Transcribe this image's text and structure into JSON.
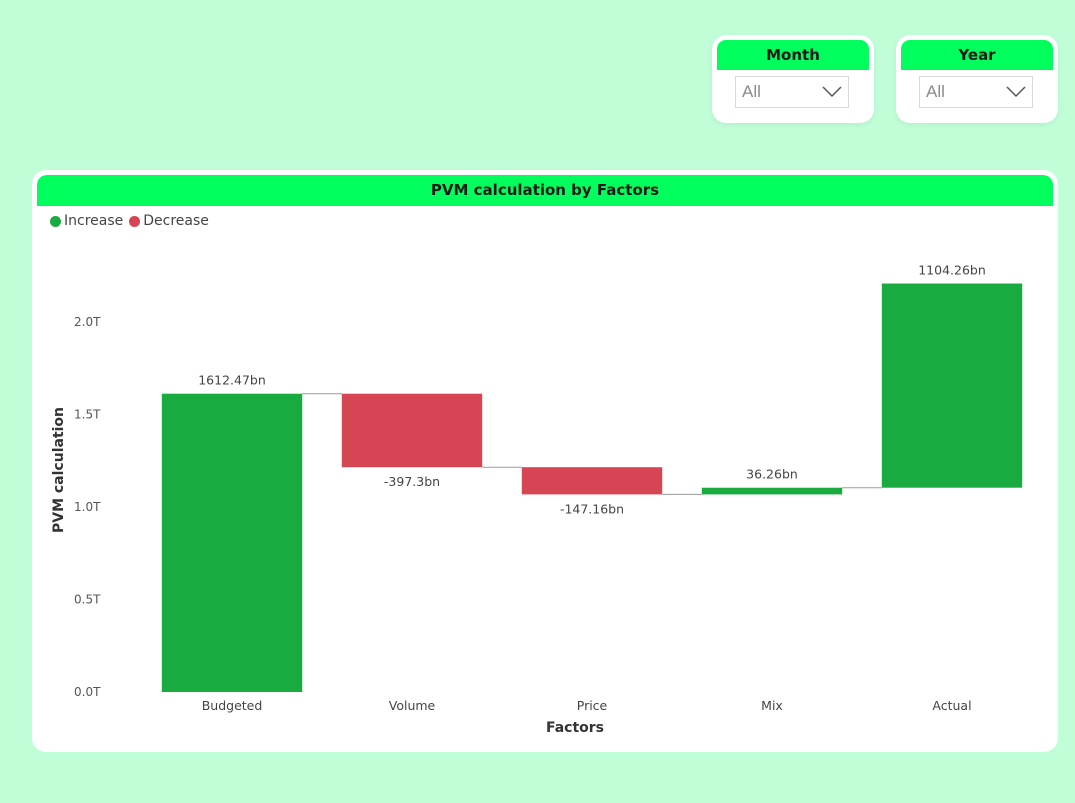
{
  "slicers": {
    "month": {
      "label": "Month",
      "value": "All"
    },
    "year": {
      "label": "Year",
      "value": "All"
    }
  },
  "colors": {
    "background": "#c0fed8",
    "header": "#00ff5c",
    "increase": "#1aab40",
    "decrease": "#d64554"
  },
  "chart_data": {
    "type": "waterfall",
    "title": "PVM calculation by Factors",
    "xlabel": "Factors",
    "ylabel": "PVM calculation",
    "legend": [
      "Increase",
      "Decrease"
    ],
    "legend_position": "top-left",
    "ylim": [
      0,
      2.3
    ],
    "y_ticks": [
      "0.0T",
      "0.5T",
      "1.0T",
      "1.5T",
      "2.0T"
    ],
    "y_tick_values": [
      0,
      0.5,
      1.0,
      1.5,
      2.0
    ],
    "grid": false,
    "categories": [
      "Budgeted",
      "Volume",
      "Price",
      "Mix",
      "Actual"
    ],
    "data_labels": [
      "1612.47bn",
      "-397.3bn",
      "-147.16bn",
      "36.26bn",
      "1104.26bn"
    ],
    "bars": [
      {
        "start": 0,
        "end": 1.61247,
        "kind": "increase"
      },
      {
        "start": 1.61247,
        "end": 1.21517,
        "kind": "decrease"
      },
      {
        "start": 1.21517,
        "end": 1.06801,
        "kind": "decrease"
      },
      {
        "start": 1.06801,
        "end": 1.10427,
        "kind": "increase"
      },
      {
        "start": 1.10427,
        "end": 2.208,
        "kind": "increase"
      }
    ]
  }
}
